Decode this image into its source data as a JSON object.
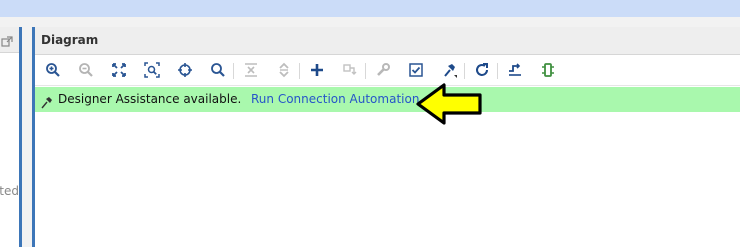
{
  "diagram": {
    "title": "Diagram"
  },
  "toolbar": {
    "buttons": [
      {
        "name": "zoom-in",
        "enabled": true
      },
      {
        "name": "zoom-out",
        "enabled": false
      },
      {
        "name": "zoom-fit",
        "enabled": true
      },
      {
        "name": "zoom-selected",
        "enabled": true
      },
      {
        "name": "auto-fit-selection",
        "enabled": true
      },
      {
        "name": "search",
        "enabled": true
      },
      {
        "name": "collapse-all",
        "enabled": false
      },
      {
        "name": "expand-all",
        "enabled": false
      },
      {
        "name": "add-ip",
        "enabled": true
      },
      {
        "name": "make-connection",
        "enabled": false
      },
      {
        "name": "customize-block",
        "enabled": false
      },
      {
        "name": "validate-design",
        "enabled": true
      },
      {
        "name": "run-connection-automation",
        "enabled": true
      },
      {
        "name": "regenerate-layout",
        "enabled": true
      },
      {
        "name": "default-view",
        "enabled": true
      },
      {
        "name": "add-module",
        "enabled": true
      }
    ]
  },
  "banner": {
    "message": "Designer Assistance available.",
    "link": "Run Connection Automation",
    "color": "#a9f8ad",
    "link_color": "#2755c9"
  },
  "left_panel": {
    "fragment_text": "cted"
  },
  "annotation": {
    "arrow_color": "#ffff00"
  },
  "colors": {
    "accent": "#3d76b8",
    "top_strip": "#cbdcf8"
  }
}
